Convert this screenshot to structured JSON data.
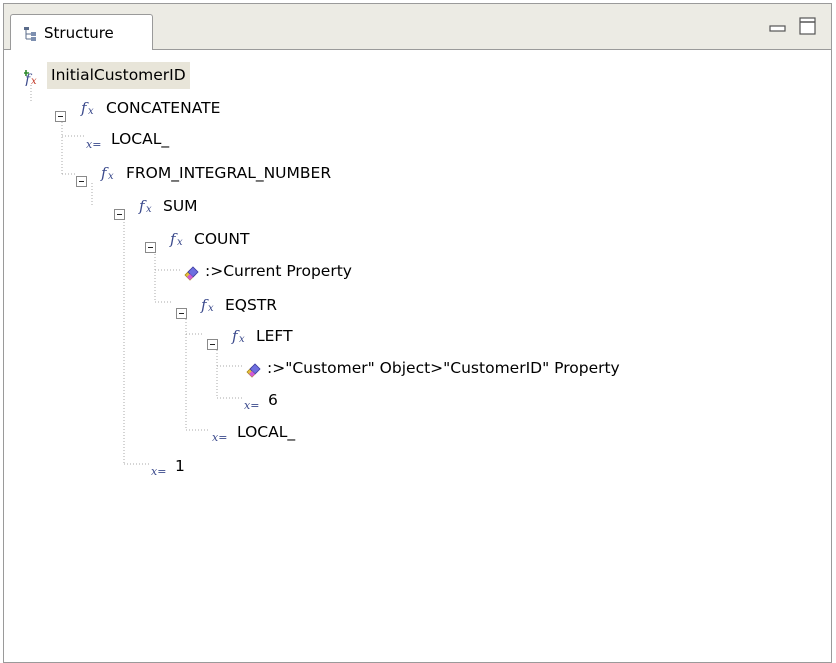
{
  "view": {
    "tab_label": "Structure",
    "tab_icon": "structure-tree-icon",
    "minimize_icon": "minimize-icon",
    "maximize_icon": "maximize-icon"
  },
  "tree": {
    "root": {
      "label": "InitialCustomerID",
      "icon": "new-function-icon",
      "selected": true
    },
    "nodes": [
      {
        "label": "CONCATENATE",
        "icon": "function-icon",
        "expanded": true
      },
      {
        "label": "LOCAL_",
        "icon": "constant-icon"
      },
      {
        "label": "FROM_INTEGRAL_NUMBER",
        "icon": "function-icon",
        "expanded": true
      },
      {
        "label": "SUM",
        "icon": "function-icon",
        "expanded": true
      },
      {
        "label": "COUNT",
        "icon": "function-icon",
        "expanded": true
      },
      {
        "label": ":>Current Property",
        "icon": "property-icon"
      },
      {
        "label": "EQSTR",
        "icon": "function-icon",
        "expanded": true
      },
      {
        "label": "LEFT",
        "icon": "function-icon",
        "expanded": true
      },
      {
        "label": ":>\"Customer\" Object>\"CustomerID\" Property",
        "icon": "property-icon"
      },
      {
        "label": "6",
        "icon": "constant-icon"
      },
      {
        "label": "LOCAL_",
        "icon": "constant-icon"
      },
      {
        "label": "1",
        "icon": "constant-icon"
      }
    ]
  },
  "colors": {
    "selection": "#e8e5d9",
    "function_icon": "#3b4a8c",
    "border": "#9a9a9a",
    "tabbar": "#ecebe4"
  }
}
